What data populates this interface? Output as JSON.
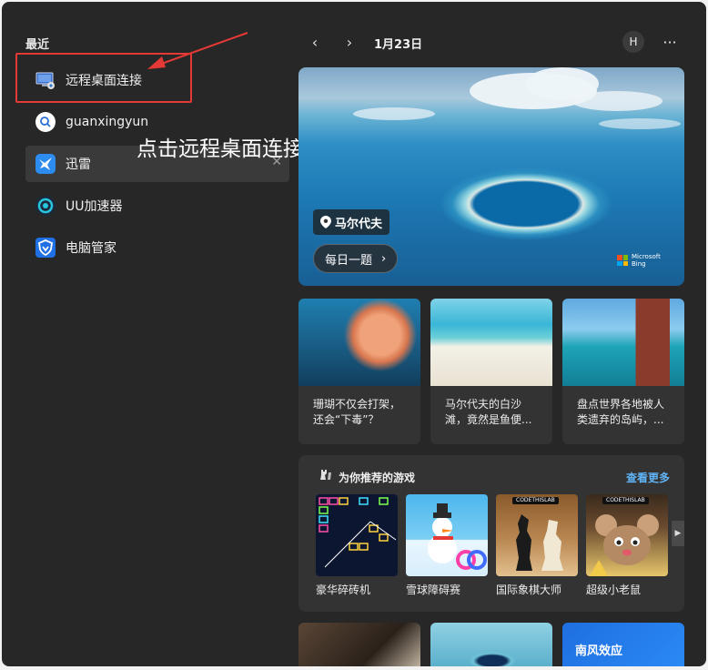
{
  "sidebar": {
    "recent_title": "最近",
    "items": [
      {
        "label": "远程桌面连接",
        "icon": "remote-desktop-icon"
      },
      {
        "label": "guanxingyun",
        "icon": "search-icon"
      },
      {
        "label": "迅雷",
        "icon": "thunder-bird-icon",
        "close": "✕"
      },
      {
        "label": "UU加速器",
        "icon": "uu-accelerator-icon"
      },
      {
        "label": "电脑管家",
        "icon": "pc-manager-shield-icon"
      }
    ]
  },
  "annotation": {
    "text": "点击远程桌面连接",
    "color": "#e53935"
  },
  "topbar": {
    "prev": "‹",
    "next": "›",
    "date": "1月23日",
    "avatar": "H",
    "more": "···"
  },
  "hero": {
    "location": "马尔代夫",
    "quiz": "每日一题",
    "quiz_chevron": "›",
    "brand_line1": "Microsoft",
    "brand_line2": "Bing"
  },
  "news": [
    {
      "title": "珊瑚不仅会打架，还会“下毒”？"
    },
    {
      "title": "马尔代夫的白沙滩，竟然是鱼便..."
    },
    {
      "title": "盘点世界各地被人类遗弃的岛屿，..."
    }
  ],
  "games": {
    "title": "为你推荐的游戏",
    "more": "查看更多",
    "publisher_tag": "CODETHISLAB",
    "scroll_arrow": "▶",
    "items": [
      {
        "name": "豪华碎砖机"
      },
      {
        "name": "雪球障碍赛"
      },
      {
        "name": "国际象棋大师"
      },
      {
        "name": "超级小老鼠"
      }
    ]
  },
  "bottom_cards": [
    {
      "title": ""
    },
    {
      "title": ""
    },
    {
      "title": "南风效应"
    }
  ],
  "colors": {
    "panel": "#272727",
    "card": "#333333",
    "accent_link": "#60b3f5",
    "highlight": "#e53935"
  }
}
